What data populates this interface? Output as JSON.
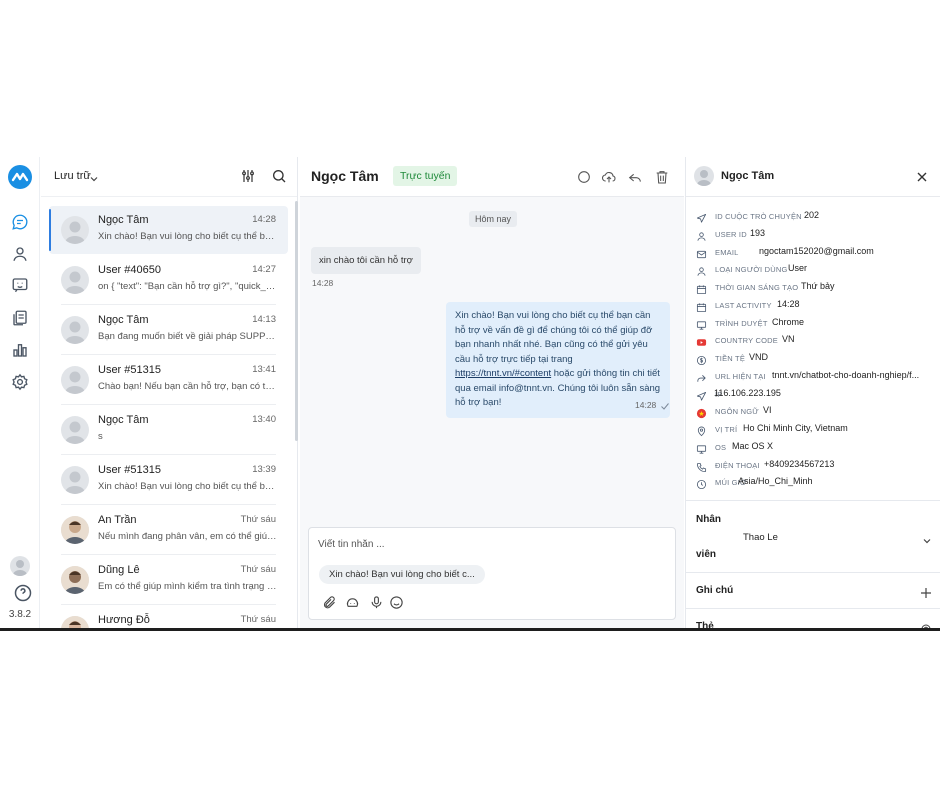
{
  "rail": {
    "version": "3.8.2",
    "colors": {
      "accent": "#1a8fe3"
    }
  },
  "list": {
    "title": "Lưu trữ",
    "conversations": [
      {
        "name": "Ngọc Tâm",
        "time": "14:28",
        "preview": "Xin chào! Bạn vui lòng cho biết cụ thể bạn cần hỗ trợ",
        "active": true
      },
      {
        "name": "User #40650",
        "time": "14:27",
        "preview": "on { \"text\": \"Bạn cần hỗ trợ gì?\", \"quick_replies\": ["
      },
      {
        "name": "Ngọc Tâm",
        "time": "14:13",
        "preview": "Bạn đang muốn biết về giải pháp SUPPORT nào?"
      },
      {
        "name": "User #51315",
        "time": "13:41",
        "preview": "Chào bạn! Nếu bạn cần hỗ trợ, bạn có thể liên hệ"
      },
      {
        "name": "Ngọc Tâm",
        "time": "13:40",
        "preview": "s"
      },
      {
        "name": "User #51315",
        "time": "13:39",
        "preview": "Xin chào! Bạn vui lòng cho biết cụ thể bạn cần hỗ trợ"
      },
      {
        "name": "An Trần",
        "time": "Thứ sáu",
        "preview": "Nếu mình đang phân vân, em có thể giúp mình"
      },
      {
        "name": "Dũng Lê",
        "time": "Thứ sáu",
        "preview": "Em có thể giúp mình kiểm tra tình trạng đơn hàng"
      },
      {
        "name": "Hương Đỗ",
        "time": "Thứ sáu",
        "preview": ""
      }
    ]
  },
  "chat": {
    "contact_name": "Ngọc Tâm",
    "status": "Trực tuyến",
    "date_chip": "Hôm nay",
    "incoming": {
      "text": "xin chào tôi cần hỗ trợ",
      "time": "14:28"
    },
    "outgoing": {
      "line1": "Xin chào! Bạn vui lòng cho biết cụ thể bạn cần hỗ trợ về vấn đề gì để chúng tôi có thể giúp đỡ bạn nhanh nhất nhé. Bạn cũng có thể gửi yêu cầu hỗ trợ trực tiếp tại trang",
      "link": "https://tnnt.vn/#content",
      "line2": "hoặc gửi thông tin chi tiết qua email info@tnnt.vn. Chúng tôi luôn sẵn sàng hỗ trợ bạn!",
      "time": "14:28"
    },
    "composer": {
      "placeholder": "Viết tin nhắn ...",
      "quick_reply": "Xin chào! Bạn vui lòng cho biết c..."
    }
  },
  "panel": {
    "name": "Ngọc Tâm",
    "rows": [
      {
        "icon": "send-icon",
        "label": "ID cuộc trò chuyện",
        "value": "202"
      },
      {
        "icon": "user-icon",
        "label": "User ID",
        "value": "193"
      },
      {
        "icon": "mail-icon",
        "label": "Email",
        "value": "ngoctam152020@gmail.com"
      },
      {
        "icon": "user-icon",
        "label": "Loại người dùng",
        "value": "User"
      },
      {
        "icon": "calendar-icon",
        "label": "Thời gian sáng tạo",
        "value": "Thứ bảy"
      },
      {
        "icon": "calendar-icon",
        "label": "Last activity",
        "value": "14:28"
      },
      {
        "icon": "monitor-icon",
        "label": "Trình duyệt",
        "value": "Chrome"
      },
      {
        "icon": "youtube-icon",
        "label": "Country code",
        "value": "VN"
      },
      {
        "icon": "currency-icon",
        "label": "Tiền tệ",
        "value": "VND"
      },
      {
        "icon": "redirect-icon",
        "label": "URL hiện tại",
        "value": "tnnt.vn/chatbot-cho-doanh-nghiep/f..."
      },
      {
        "icon": "send-icon",
        "label": "IP",
        "value": "116.106.223.195"
      },
      {
        "icon": "flag-vn-icon",
        "label": "Ngôn ngữ",
        "value": "VI"
      },
      {
        "icon": "location-icon",
        "label": "Vị trí",
        "value": "Ho Chi Minh City, Vietnam"
      },
      {
        "icon": "monitor-icon",
        "label": "OS",
        "value": "Mac OS X"
      },
      {
        "icon": "phone-icon",
        "label": "Điện thoại",
        "value": "+8409234567213"
      },
      {
        "icon": "clock-icon",
        "label": "Múi giờ",
        "value": "Asia/Ho_Chi_Minh"
      }
    ],
    "staff": {
      "title": "Nhân",
      "title2": "viên",
      "value": "Thao Le"
    },
    "notes": {
      "title": "Ghi chú"
    },
    "tags": {
      "title": "Thẻ"
    }
  }
}
